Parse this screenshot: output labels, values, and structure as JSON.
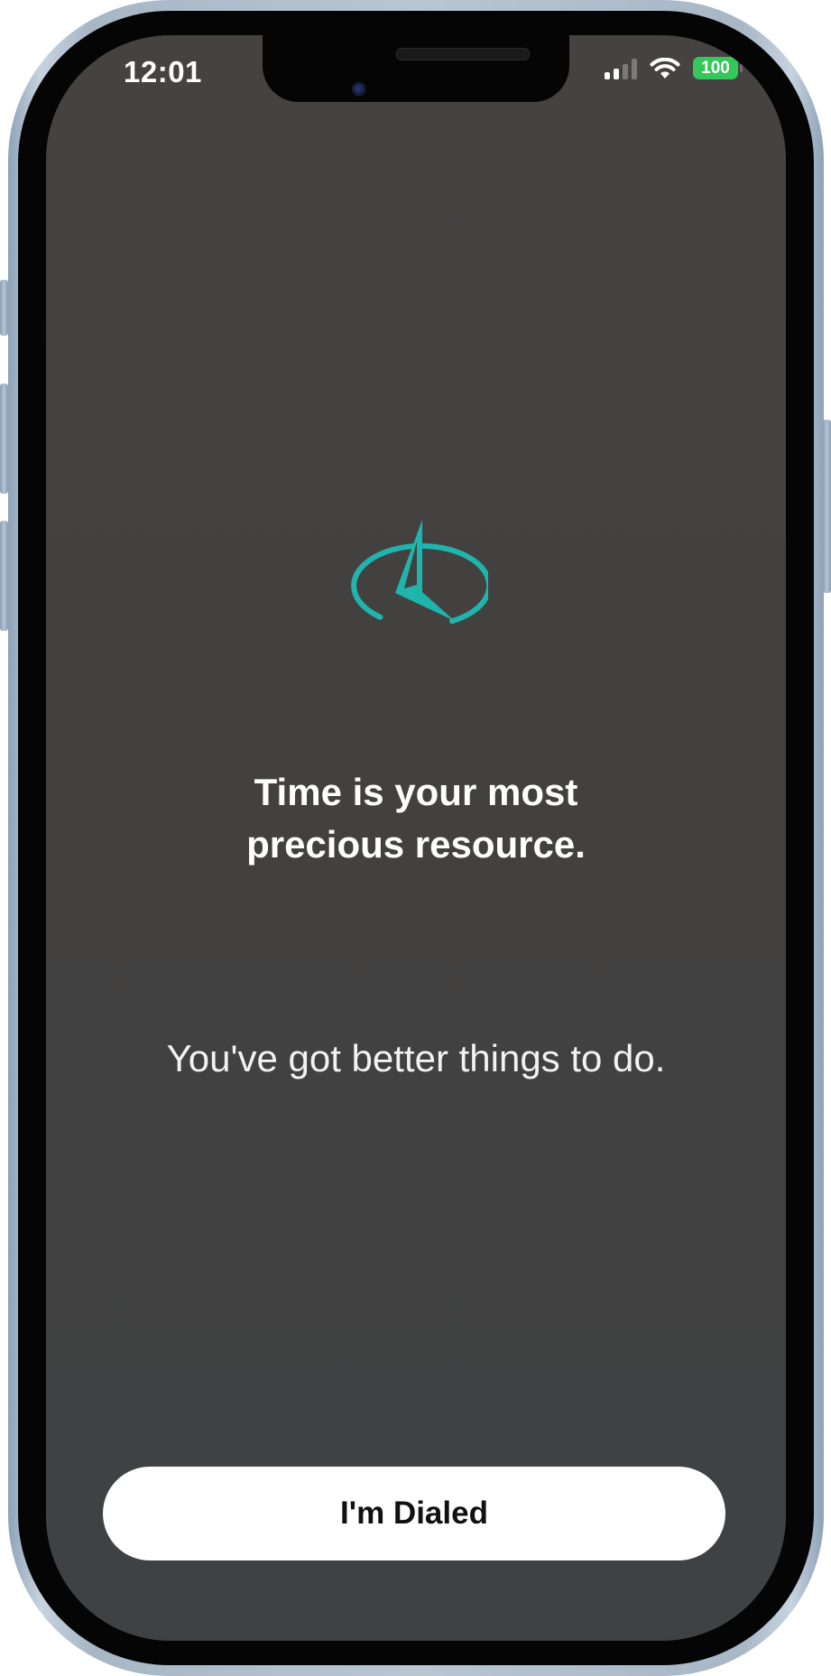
{
  "status_bar": {
    "time": "12:01",
    "battery_level": "100",
    "signal_bars_active": 2,
    "signal_bars_total": 4
  },
  "onboarding": {
    "headline_line1": "Time is your most",
    "headline_line2": "precious resource.",
    "subtext": "You've got better things to do.",
    "primary_button_label": "I'm Dialed"
  },
  "icons": {
    "logo": "sundial-logo-icon",
    "signal": "cellular-signal-icon",
    "wifi": "wifi-icon",
    "battery": "battery-icon"
  },
  "colors": {
    "accent": "#1fb5ad",
    "background": "#434140",
    "text": "#ffffff",
    "button_bg": "#ffffff",
    "button_text": "#111111",
    "battery": "#34c759"
  }
}
